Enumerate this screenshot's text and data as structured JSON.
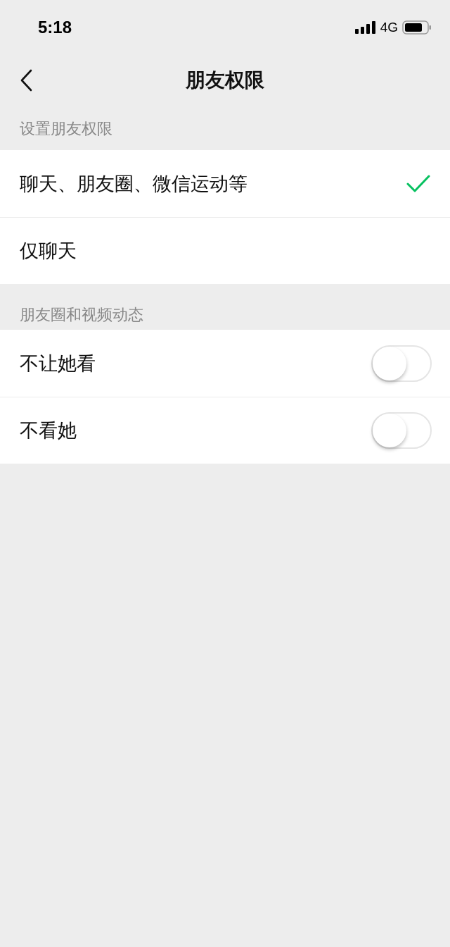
{
  "status_bar": {
    "time": "5:18",
    "network": "4G"
  },
  "nav": {
    "title": "朋友权限"
  },
  "sections": [
    {
      "header": "设置朋友权限",
      "items": [
        {
          "kind": "choice",
          "label": "聊天、朋友圈、微信运动等",
          "selected": true
        },
        {
          "kind": "choice",
          "label": "仅聊天",
          "selected": false
        }
      ]
    },
    {
      "header": "朋友圈和视频动态",
      "items": [
        {
          "kind": "toggle",
          "label": "不让她看",
          "on": false
        },
        {
          "kind": "toggle",
          "label": "不看她",
          "on": false
        }
      ]
    }
  ]
}
